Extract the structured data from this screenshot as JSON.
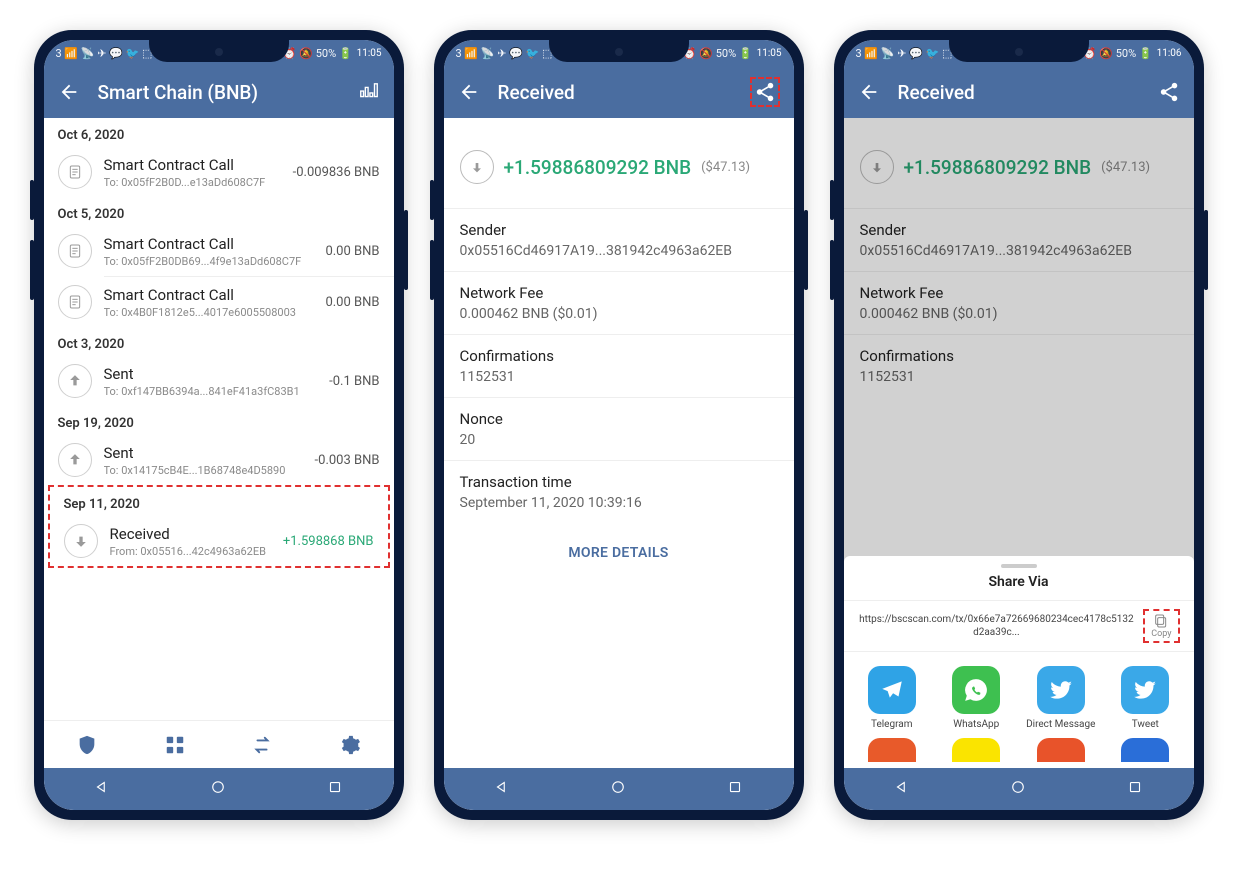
{
  "colors": {
    "primary": "#4a6da0",
    "green": "#2aa876",
    "red_dash": "#e03030"
  },
  "screen1": {
    "status": {
      "left_icons": "3 📶 📡 ✈ 💬 🐦 ⬚",
      "right_icons": "ℕ ⏰ 🔕 50% 🔋",
      "time": "11:05"
    },
    "title": "Smart Chain (BNB)",
    "sections": [
      {
        "date": "Oct 6, 2020",
        "txs": [
          {
            "icon": "contract-icon",
            "title": "Smart Contract Call",
            "sub": "To: 0x05fF2B0D...e13aDd608C7F",
            "amt": "-0.009836 BNB",
            "pos": false
          }
        ]
      },
      {
        "date": "Oct 5, 2020",
        "txs": [
          {
            "icon": "contract-icon",
            "title": "Smart Contract Call",
            "sub": "To: 0x05fF2B0DB69...4f9e13aDd608C7F",
            "amt": "0.00 BNB",
            "pos": false
          },
          {
            "icon": "contract-icon",
            "title": "Smart Contract Call",
            "sub": "To: 0x4B0F1812e5...4017e6005508003",
            "amt": "0.00 BNB",
            "pos": false
          }
        ]
      },
      {
        "date": "Oct 3, 2020",
        "txs": [
          {
            "icon": "sent-icon",
            "title": "Sent",
            "sub": "To: 0xf147BB6394a...841eF41a3fC83B1",
            "amt": "-0.1 BNB",
            "pos": false
          }
        ]
      },
      {
        "date": "Sep 19, 2020",
        "txs": [
          {
            "icon": "sent-icon",
            "title": "Sent",
            "sub": "To: 0x14175cB4E...1B68748e4D5890",
            "amt": "-0.003 BNB",
            "pos": false
          }
        ]
      }
    ],
    "highlight": {
      "date": "Sep 11, 2020",
      "tx": {
        "icon": "received-icon",
        "title": "Received",
        "sub": "From: 0x05516...42c4963a62EB",
        "amt": "+1.598868 BNB",
        "pos": true
      }
    }
  },
  "screen2": {
    "status": {
      "left_icons": "3 📶 📡 ✈ 💬 🐦 ⬚",
      "right_icons": "ℕ ⏰ 🔕 50% 🔋",
      "time": "11:05"
    },
    "title": "Received",
    "amount": "+1.59886809292 BNB",
    "usd": "($47.13)",
    "details": [
      {
        "label": "Sender",
        "value": "0x05516Cd46917A19...381942c4963a62EB"
      },
      {
        "label": "Network Fee",
        "value": "0.000462 BNB ($0.01)"
      },
      {
        "label": "Confirmations",
        "value": "1152531"
      },
      {
        "label": "Nonce",
        "value": "20"
      },
      {
        "label": "Transaction time",
        "value": "September 11, 2020 10:39:16"
      }
    ],
    "more": "MORE DETAILS"
  },
  "screen3": {
    "status": {
      "left_icons": "3 📶 📡 ✈ 💬 🐦 ⬚",
      "right_icons": "ℕ ⏰ 🔕 50% 🔋",
      "time": "11:06"
    },
    "title": "Received",
    "amount": "+1.59886809292 BNB",
    "usd": "($47.13)",
    "details": [
      {
        "label": "Sender",
        "value": "0x05516Cd46917A19...381942c4963a62EB"
      },
      {
        "label": "Network Fee",
        "value": "0.000462 BNB ($0.01)"
      },
      {
        "label": "Confirmations",
        "value": "1152531"
      }
    ],
    "share": {
      "title": "Share Via",
      "link": "https://bscscan.com/tx/0x66e7a72669680234cec4178c5132d2aa39c...",
      "copy": "Copy",
      "apps": [
        {
          "name": "Telegram",
          "color": "#2fa3e6",
          "icon": "telegram-icon"
        },
        {
          "name": "WhatsApp",
          "color": "#3ec050",
          "icon": "whatsapp-icon"
        },
        {
          "name": "Direct Message",
          "color": "#3aa8e8",
          "icon": "twitter-icon"
        },
        {
          "name": "Tweet",
          "color": "#3aa8e8",
          "icon": "twitter-icon"
        }
      ],
      "apps2": [
        {
          "color": "#e85a2a"
        },
        {
          "color": "#fae400"
        },
        {
          "color": "#e8532a"
        },
        {
          "color": "#2a6ed8"
        }
      ]
    }
  }
}
